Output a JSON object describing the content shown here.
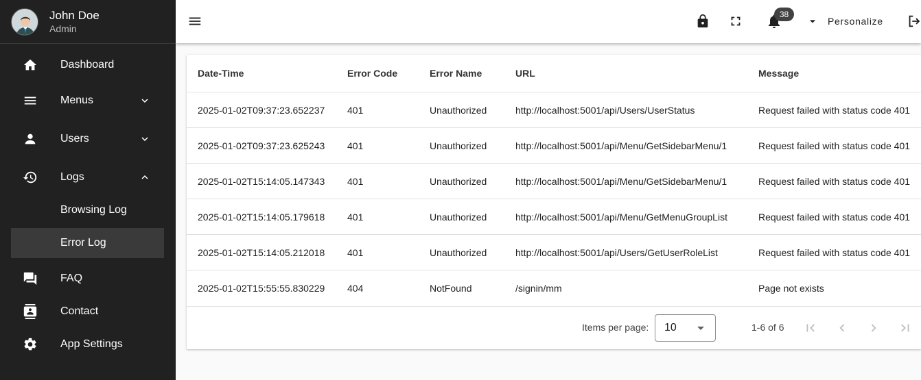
{
  "user": {
    "name": "John Doe",
    "role": "Admin"
  },
  "sidebar": {
    "items": [
      {
        "label": "Dashboard",
        "icon": "home-icon"
      },
      {
        "label": "Menus",
        "icon": "menu-lines-icon",
        "expandable": true,
        "expanded": false
      },
      {
        "label": "Users",
        "icon": "person-icon",
        "expandable": true,
        "expanded": false
      },
      {
        "label": "Logs",
        "icon": "history-icon",
        "expandable": true,
        "expanded": true
      },
      {
        "label": "Browsing Log",
        "sub": true
      },
      {
        "label": "Error Log",
        "sub": true,
        "active": true
      },
      {
        "label": "FAQ",
        "icon": "forum-icon"
      },
      {
        "label": "Contact",
        "icon": "contact-icon"
      },
      {
        "label": "App Settings",
        "icon": "gear-icon"
      }
    ]
  },
  "toolbar": {
    "notification_count": "38",
    "personalize_label": "Personalize"
  },
  "table": {
    "headers": [
      "Date-Time",
      "Error Code",
      "Error Name",
      "URL",
      "Message"
    ],
    "rows": [
      [
        "2025-01-02T09:37:23.652237",
        "401",
        "Unauthorized",
        "http://localhost:5001/api/Users/UserStatus",
        "Request failed with status code 401"
      ],
      [
        "2025-01-02T09:37:23.625243",
        "401",
        "Unauthorized",
        "http://localhost:5001/api/Menu/GetSidebarMenu/1",
        "Request failed with status code 401"
      ],
      [
        "2025-01-02T15:14:05.147343",
        "401",
        "Unauthorized",
        "http://localhost:5001/api/Menu/GetSidebarMenu/1",
        "Request failed with status code 401"
      ],
      [
        "2025-01-02T15:14:05.179618",
        "401",
        "Unauthorized",
        "http://localhost:5001/api/Menu/GetMenuGroupList",
        "Request failed with status code 401"
      ],
      [
        "2025-01-02T15:14:05.212018",
        "401",
        "Unauthorized",
        "http://localhost:5001/api/Users/GetUserRoleList",
        "Request failed with status code 401"
      ],
      [
        "2025-01-02T15:55:55.830229",
        "404",
        "NotFound",
        "/signin/mm",
        "Page not exists"
      ]
    ]
  },
  "paginator": {
    "items_per_page_label": "Items per page:",
    "items_per_page_value": "10",
    "range_label": "1-6 of 6"
  },
  "colors": {
    "sidebar_bg": "#212121",
    "active_item_bg": "#3a3a3a",
    "badge_bg": "#424242"
  }
}
